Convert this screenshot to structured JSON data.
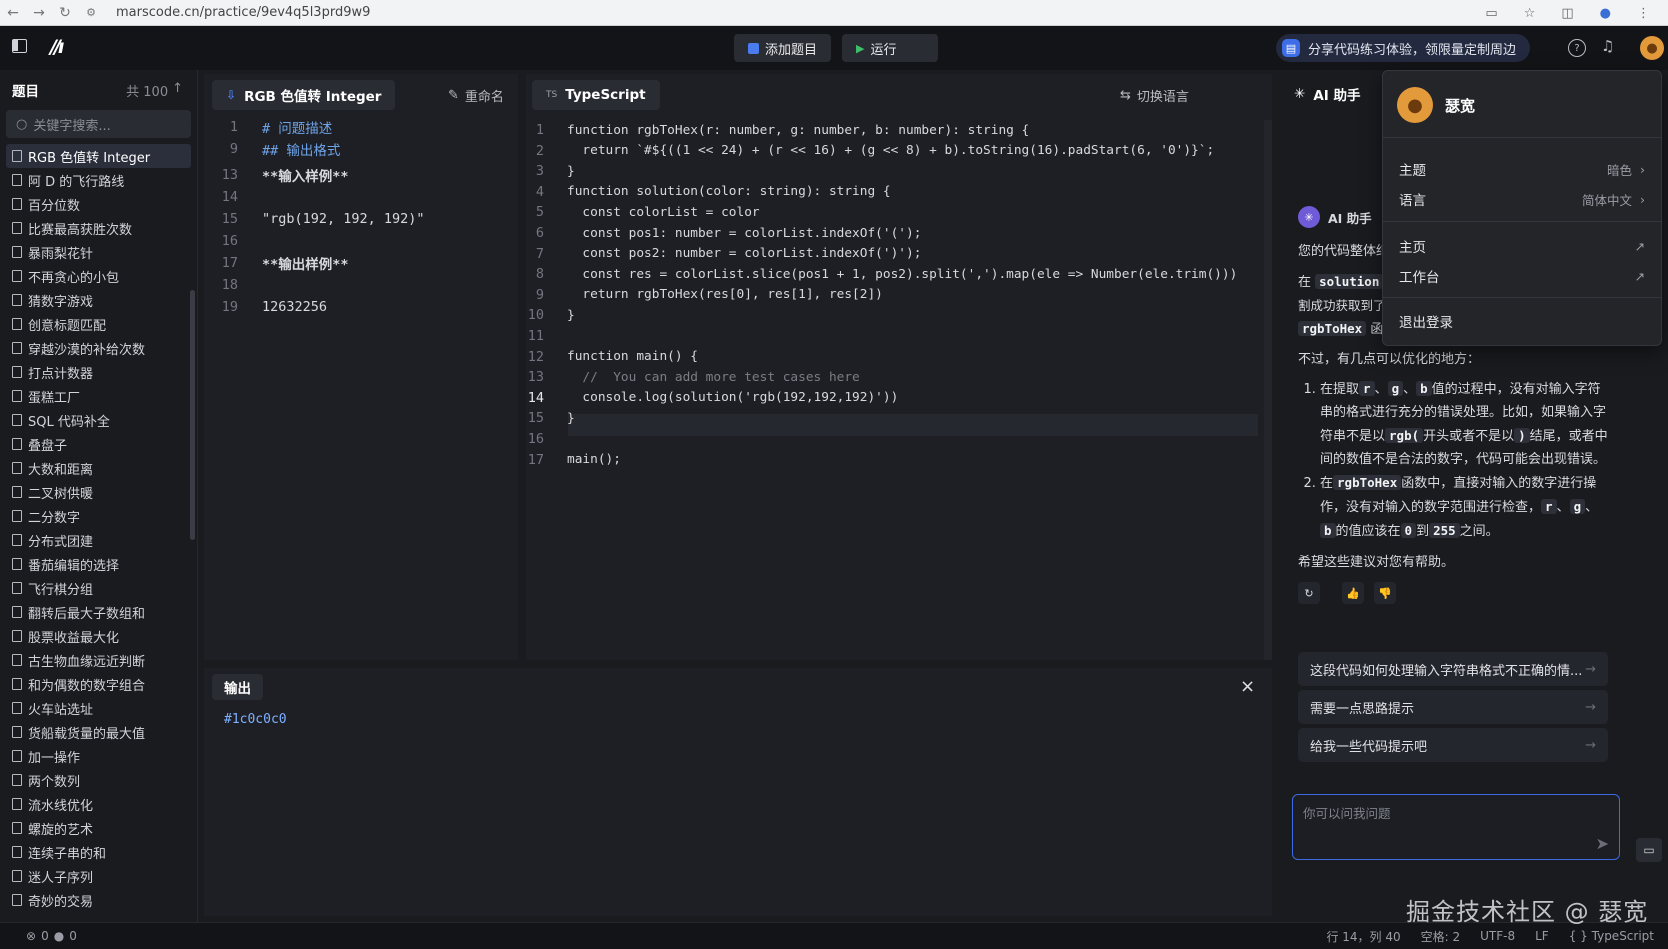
{
  "browser": {
    "url": "marscode.cn/practice/9ev4q5l3prd9w9"
  },
  "toolbar": {
    "add_problem": "添加题目",
    "run": "运行",
    "share_banner": "分享代码练习体验，领限量定制周边"
  },
  "sidebar": {
    "title": "题目",
    "count": "共 100",
    "search_placeholder": "关键字搜索...",
    "items": [
      "RGB 色值转 Integer",
      "阿 D 的飞行路线",
      "百分位数",
      "比赛最高获胜次数",
      "暴雨梨花针",
      "不再贪心的小包",
      "猜数字游戏",
      "创意标题匹配",
      "穿越沙漠的补给次数",
      "打点计数器",
      "蛋糕工厂",
      "SQL 代码补全",
      "叠盘子",
      "大数和距离",
      "二叉树供暖",
      "二分数字",
      "分布式团建",
      "番茄编辑的选择",
      "飞行棋分组",
      "翻转后最大子数组和",
      "股票收益最大化",
      "古生物血缘远近判断",
      "和为偶数的数字组合",
      "火车站选址",
      "货船载货量的最大值",
      "加一操作",
      "两个数列",
      "流水线优化",
      "螺旋的艺术",
      "连续子串的和",
      "迷人子序列",
      "奇妙的交易"
    ],
    "active_index": 0
  },
  "problem": {
    "tab": "RGB 色值转 Integer",
    "rename": "重命名",
    "lines": [
      {
        "n": "1",
        "t": "# 问题描述"
      },
      {
        "n": "9",
        "t": "## 输出格式"
      },
      {
        "n": "13",
        "t": "**输入样例**"
      },
      {
        "n": "14",
        "t": ""
      },
      {
        "n": "15",
        "t": "\"rgb(192, 192, 192)\""
      },
      {
        "n": "16",
        "t": ""
      },
      {
        "n": "17",
        "t": "**输出样例**"
      },
      {
        "n": "18",
        "t": ""
      },
      {
        "n": "19",
        "t": "12632256"
      }
    ]
  },
  "editor": {
    "lang_badge": "TS",
    "tab": "TypeScript",
    "switch_lang": "切换语言",
    "current_line": "14",
    "lines": [
      "function rgbToHex(r: number, g: number, b: number): string {",
      "  return `#${((1 << 24) + (r << 16) + (g << 8) + b).toString(16).padStart(6, '0')}`;",
      "}",
      "function solution(color: string): string {",
      "  const colorList = color",
      "  const pos1: number = colorList.indexOf('(');",
      "  const pos2: number = colorList.indexOf(')');",
      "  const res = colorList.slice(pos1 + 1, pos2).split(',').map(ele => Number(ele.trim()))",
      "  return rgbToHex(res[0], res[1], res[2])",
      "}",
      "",
      "function main() {",
      "  //  You can add more test cases here",
      "  console.log(solution('rgb(192,192,192)'))",
      "}",
      "",
      "main();"
    ]
  },
  "output": {
    "tab": "输出",
    "text": "#1c0c0c0",
    "close": "×"
  },
  "ai": {
    "title": "AI 助手",
    "sender": "AI 助手",
    "p1": "您的代码整体结",
    "p2_a": "在",
    "p2_chip": "solution",
    "p3": "割成功获取到了",
    "p4_chip": "rgbToHex",
    "p4_b": "函",
    "p5": "不过，有几点可以优化的地方：",
    "li1": [
      "在提取",
      "r",
      "、",
      "g",
      "、",
      "b",
      "值的过程中，没有对输入字符串的格式进行充分的错误处理。比如，如果输入字符串不是以",
      "rgb(",
      "开头或者不是以",
      ")",
      "结尾，或者中间的数值不是合法的数字，代码可能会出现错误。"
    ],
    "li2": [
      "在",
      "rgbToHex",
      "函数中，直接对输入的数字进行操作，没有对输入的数字范围进行检查，",
      "r",
      "、",
      "g",
      "、",
      "b",
      "的值应该在",
      "0",
      "到",
      "255",
      "之间。"
    ],
    "closing": "希望这些建议对您有帮助。",
    "suggestions": [
      "这段代码如何处理输入字符串格式不正确的情...",
      "需要一点思路提示",
      "给我一些代码提示吧"
    ],
    "input_placeholder": "你可以问我问题"
  },
  "menu": {
    "user": "瑟宽",
    "theme_label": "主题",
    "theme_value": "暗色",
    "lang_label": "语言",
    "lang_value": "简体中文",
    "home": "主页",
    "workspace": "工作台",
    "logout": "退出登录"
  },
  "status": {
    "errors": "0",
    "warnings": "0",
    "position": "行 14，列 40",
    "spaces": "空格: 2",
    "encoding": "UTF-8",
    "eol": "LF",
    "language": "TypeScript"
  },
  "watermark": "掘金技术社区 @ 瑟宽",
  "colors": {
    "accent": "#4a7cf0",
    "bg": "#1a1b1f",
    "panel": "#1e1f24"
  }
}
